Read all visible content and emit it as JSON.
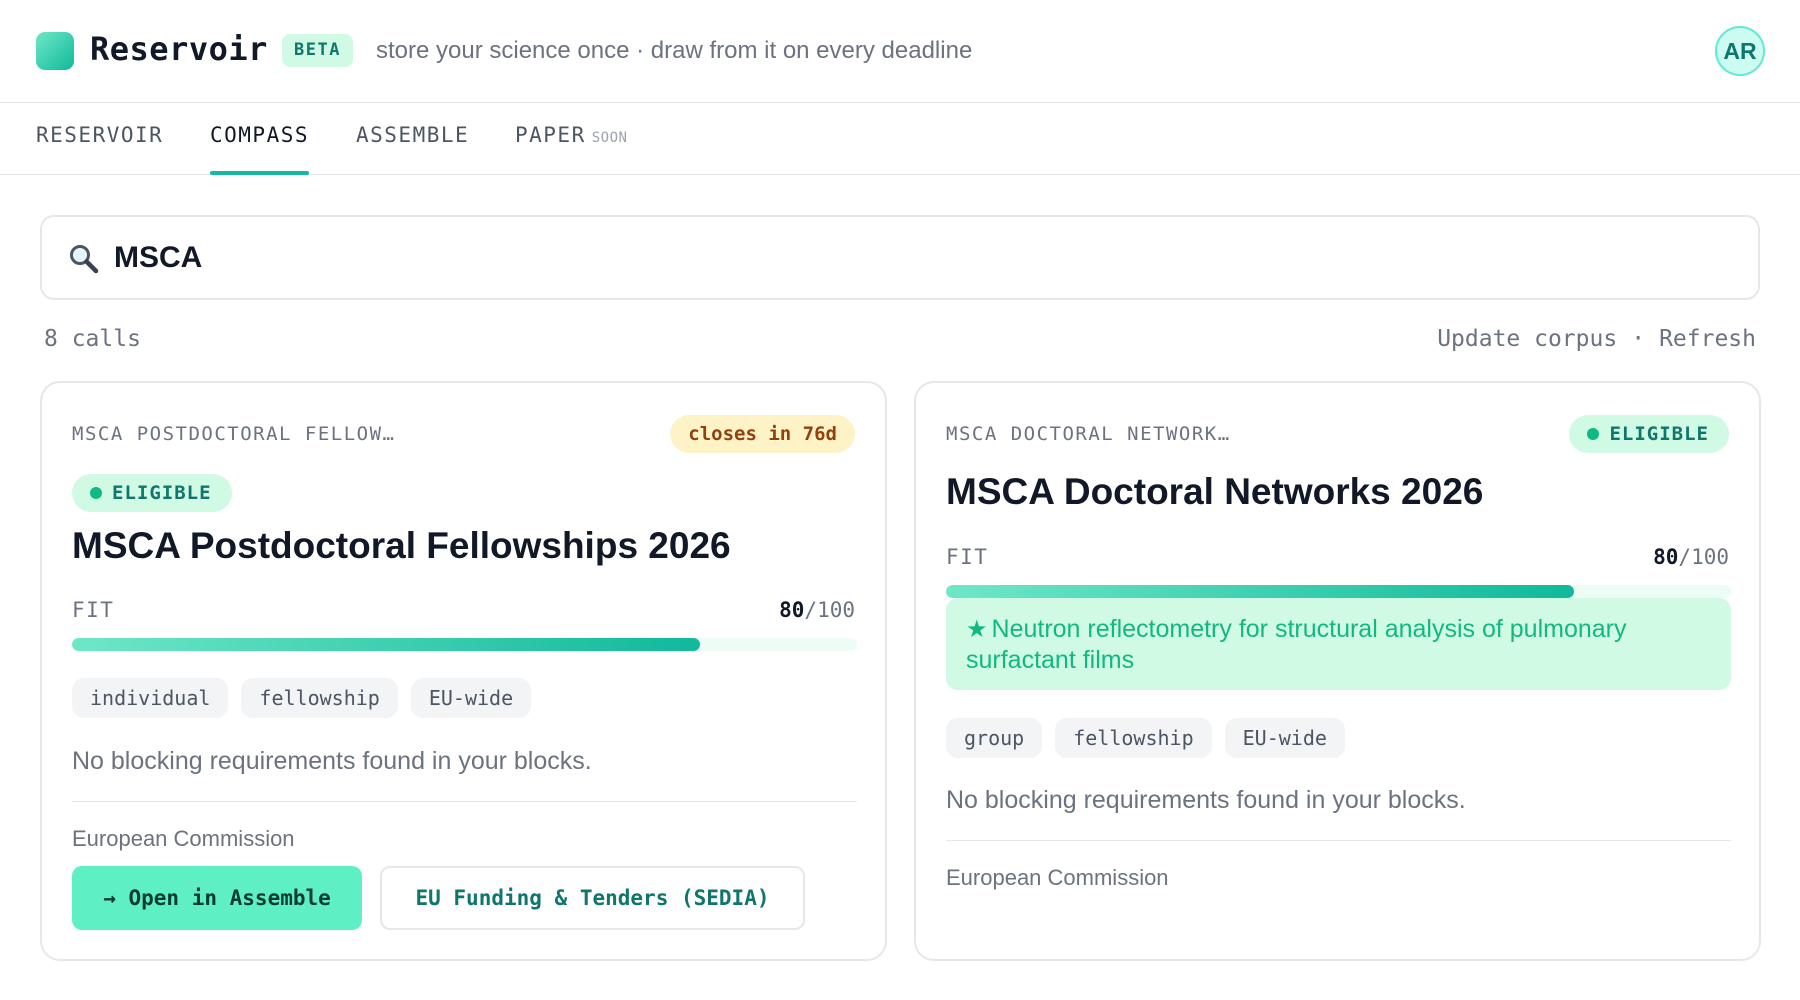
{
  "app": {
    "name": "Reservoir",
    "badge": "BETA",
    "tagline": "store your science once · draw from it on every deadline",
    "avatar_initials": "AR"
  },
  "tabs": [
    {
      "label": "RESERVOIR",
      "active": false
    },
    {
      "label": "COMPASS",
      "active": true
    },
    {
      "label": "ASSEMBLE",
      "active": false
    },
    {
      "label": "PAPER",
      "suffix": "SOON",
      "active": false
    }
  ],
  "search": {
    "value": "MSCA"
  },
  "results": {
    "count_label": "8 calls",
    "update_label": "Update corpus",
    "separator": "·",
    "refresh_label": "Refresh"
  },
  "cards": [
    {
      "eyebrow": "MSCA POSTDOCTORAL FELLOW…",
      "deadline": "closes in 76d",
      "status": "ELIGIBLE",
      "title": "MSCA Postdoctoral Fellowships 2026",
      "fit_label": "FIT",
      "fit_score": "80",
      "fit_max": "/100",
      "fit_fraction": 0.8,
      "tags": [
        "individual",
        "fellowship",
        "EU-wide"
      ],
      "note": "No blocking requirements found in your blocks.",
      "funder": "European Commission",
      "primary_action": "→ Open in Assemble",
      "secondary_action": "EU Funding & Tenders (SEDIA)"
    },
    {
      "eyebrow": "MSCA DOCTORAL NETWORK…",
      "status": "ELIGIBLE",
      "title": "MSCA Doctoral Networks 2026",
      "fit_label": "FIT",
      "fit_score": "80",
      "fit_max": "/100",
      "fit_fraction": 0.8,
      "match_star": "★",
      "match_text": "Neutron reflectometry for structural analysis of pulmonary surfactant films",
      "tags": [
        "group",
        "fellowship",
        "EU-wide"
      ],
      "note": "No blocking requirements found in your blocks.",
      "funder": "European Commission"
    }
  ],
  "icons": {
    "search": "search-icon",
    "logo": "logo-icon"
  },
  "colors": {
    "accent": "#14b8a6",
    "eligible_bg": "#d1fae5",
    "deadline_bg": "#fef3c7"
  }
}
